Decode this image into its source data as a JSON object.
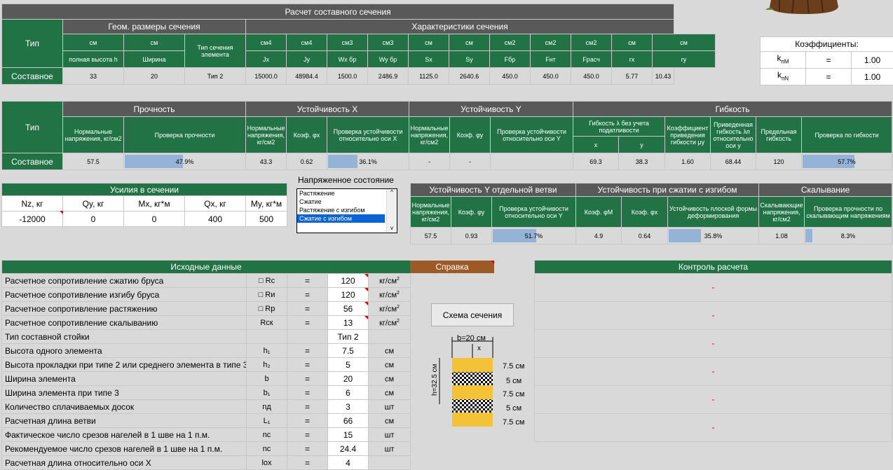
{
  "composite": {
    "title": "Расчет составного сечения",
    "type_header": "Тип",
    "geom_header": "Геом. размеры сечения",
    "char_header": "Характеристики сечения",
    "units": [
      "см",
      "см",
      "см4",
      "см4",
      "см3",
      "см3",
      "см",
      "см",
      "см2",
      "см2",
      "см2",
      "см",
      "см"
    ],
    "labels": [
      "полная высота h",
      "Ширина",
      "Тип сечения элемента",
      "Jx",
      "Jy",
      "Wx бр",
      "Wy бр",
      "Sx",
      "Sy",
      "Fбр",
      "Fнт",
      "Fрасч",
      "rx",
      "ry"
    ],
    "row_label": "Составное",
    "values": [
      "33",
      "20",
      "Тип 2",
      "15000.0",
      "48984.4",
      "1500.0",
      "2486.9",
      "1125.0",
      "2640.6",
      "450.0",
      "450.0",
      "450.0",
      "5.77",
      "10.43"
    ]
  },
  "coef": {
    "title": "Коэффициенты:",
    "rows": [
      {
        "k": "k",
        "sub": "пМ",
        "eq": "=",
        "val": "1.00"
      },
      {
        "k": "k",
        "sub": "пN",
        "eq": "=",
        "val": "1.00"
      }
    ]
  },
  "checks": {
    "type_header": "Тип",
    "strength": "Прочность",
    "stab_x": "Устойчивость X",
    "stab_y": "Устойчивость Y",
    "flex": "Гибкость",
    "h_norm1": "Нормальные напряжения, кг/см2",
    "h_check_strength": "Проверка прочности",
    "h_norm2": "Нормальные напряжения, кг/см2",
    "h_phix": "Коэф. φх",
    "h_check_x": "Проверка устойчивости относительно оси X",
    "h_norm3": "Нормальные напряжения, кг/см2",
    "h_phiy": "Коэф. φу",
    "h_check_y": "Проверка устойчивости относительно оси Y",
    "h_lambda": "Гибкость λ без учета податливости",
    "h_x": "x",
    "h_y": "y",
    "h_mu": "Коэффициент приведения гибкости μу",
    "h_reduced": "Приведенная гибкость λп относительно оси у",
    "h_limit": "Предельная гибкость",
    "h_check_flex": "Проверка по гибкости",
    "row_label": "Составное",
    "v_norm1": "57.5",
    "v_strength_pct": "47.9%",
    "v_strength_frac": 0.479,
    "v_norm2": "43.3",
    "v_phix": "0.62",
    "v_x_pct": "36.1%",
    "v_x_frac": 0.361,
    "v_norm3": "-",
    "v_phiy": "-",
    "v_y_check": "",
    "v_lx": "69.3",
    "v_ly": "38.3",
    "v_mu": "1.60",
    "v_reduced": "68.44",
    "v_limit": "120",
    "v_flex_pct": "57.7%",
    "v_flex_frac": 0.577
  },
  "forces": {
    "title": "Усилия в сечении",
    "labels": [
      "Nz, кг",
      "Qy, кг",
      "Mx, кг*м",
      "Qx, кг",
      "My, кг*м"
    ],
    "values": [
      "-12000",
      "0",
      "0",
      "400",
      "500"
    ]
  },
  "stress_state": {
    "title": "Напряженное состояние",
    "options": [
      "Растяжение",
      "Сжатие",
      "Растяжение с изгибом",
      "Сжатие с изгибом"
    ],
    "selected_index": 3
  },
  "branch": {
    "t1": "Устойчивость Y отдельной ветви",
    "t2": "Устойчивость при сжатии с изгибом",
    "t3": "Скалывание",
    "h": [
      "Нормальные напряжения, кг/см2",
      "Коэф. φу",
      "Проверка устойчивости относительно оси Y",
      "Коэф. φМ",
      "Коэф. φх",
      "Устойчивость плоской формы деформирования",
      "Скалывающие напряжения, кг/см2",
      "Проверка прочности по скалывающим напряжениям"
    ],
    "v_norm": "57.5",
    "v_phiy": "0.93",
    "v_y_pct": "51.7%",
    "v_y_frac": 0.517,
    "v_phim": "4.9",
    "v_phix": "0.64",
    "v_plane_pct": "35.8%",
    "v_plane_frac": 0.358,
    "v_shear": "1.08",
    "v_shear_pct": "8.3%",
    "v_shear_frac": 0.083
  },
  "input": {
    "title": "Исходные данные",
    "rows": [
      {
        "label": "Расчетное сопротивление сжатию бруса",
        "sym": "□ Rc",
        "eq": "=",
        "val": "120",
        "unit": "кг/см",
        "sup": "2"
      },
      {
        "label": "Расчетное сопротивление изгибу бруса",
        "sym": "□ Rи",
        "eq": "=",
        "val": "120",
        "unit": "кг/см",
        "sup": "2"
      },
      {
        "label": "Расчетное сопротивление растяжению",
        "sym": "□ Rр",
        "eq": "=",
        "val": "56",
        "unit": "кг/см",
        "sup": "2"
      },
      {
        "label": "Расчетное сопротивление скалыванию",
        "sym": "Rск",
        "eq": "=",
        "val": "13",
        "unit": "кг/см",
        "sup": "2"
      },
      {
        "label": "Тип составной стойки",
        "sym": "",
        "eq": "",
        "val": "Тип 2",
        "unit": "",
        "sup": ""
      },
      {
        "label": "Высота одного элемента",
        "sym": "h₁",
        "eq": "=",
        "val": "7.5",
        "unit": "см",
        "sup": ""
      },
      {
        "label": "Высота прокладки при типе 2 или среднего элемента в типе 3",
        "sym": "h₂",
        "eq": "=",
        "val": "5",
        "unit": "см",
        "sup": ""
      },
      {
        "label": "Ширина элемента",
        "sym": "b",
        "eq": "=",
        "val": "20",
        "unit": "см",
        "sup": ""
      },
      {
        "label": "Ширина элемента при типе 3",
        "sym": "b₁",
        "eq": "=",
        "val": "6",
        "unit": "см",
        "sup": ""
      },
      {
        "label": "Количество сплачиваемых досок",
        "sym": "nд",
        "eq": "=",
        "val": "3",
        "unit": "шт",
        "sup": ""
      },
      {
        "label": "Расчетная длина ветви",
        "sym": "L₁",
        "eq": "=",
        "val": "66",
        "unit": "см",
        "sup": ""
      },
      {
        "label": "Фактическое число срезов нагелей в 1 шве на 1 п.м.",
        "sym": "nc",
        "eq": "=",
        "val": "15",
        "unit": "шт",
        "sup": ""
      },
      {
        "label": "Рекомендуемое число срезов нагелей в 1 шве на 1 п.м.",
        "sym": "nc",
        "eq": "=",
        "val": "24.4",
        "unit": "шт",
        "sup": ""
      },
      {
        "label": "Расчетная длина относительно оси X",
        "sym": "lox",
        "eq": "=",
        "val": "4",
        "unit": "",
        "sup": ""
      }
    ]
  },
  "help": {
    "label": "Справка",
    "scheme_button": "Схема сечения"
  },
  "scheme": {
    "b_label": "b=20 см",
    "x_label": "x",
    "h_label": "h=32.5 см",
    "layers": [
      "7.5 см",
      "5 см",
      "7.5 см",
      "5 см",
      "7.5 см"
    ]
  },
  "control": {
    "title": "Контроль расчета",
    "marks": [
      "-",
      "-",
      "-",
      "-",
      "-",
      "-"
    ]
  }
}
